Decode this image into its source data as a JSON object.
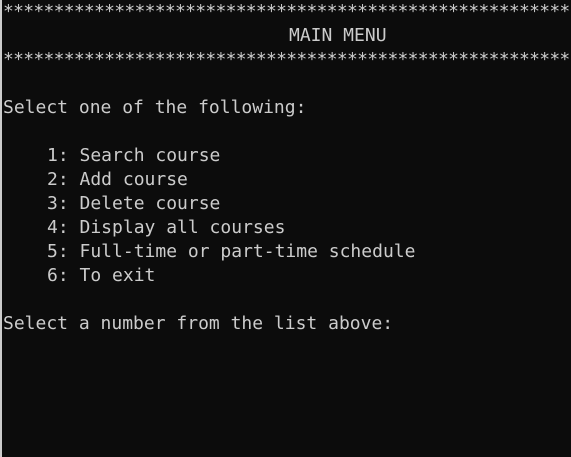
{
  "border_line": "**********************************************************************",
  "title": "MAIN MENU",
  "prompt_select": "Select one of the following:",
  "menu_items": [
    "1: Search course",
    "2: Add course",
    "3: Delete course",
    "4: Display all courses",
    "5: Full-time or part-time schedule",
    "6: To exit"
  ],
  "input_prompt": "Select a number from the list above:",
  "colors": {
    "background": "#0c0c0c",
    "text": "#cccccc"
  }
}
